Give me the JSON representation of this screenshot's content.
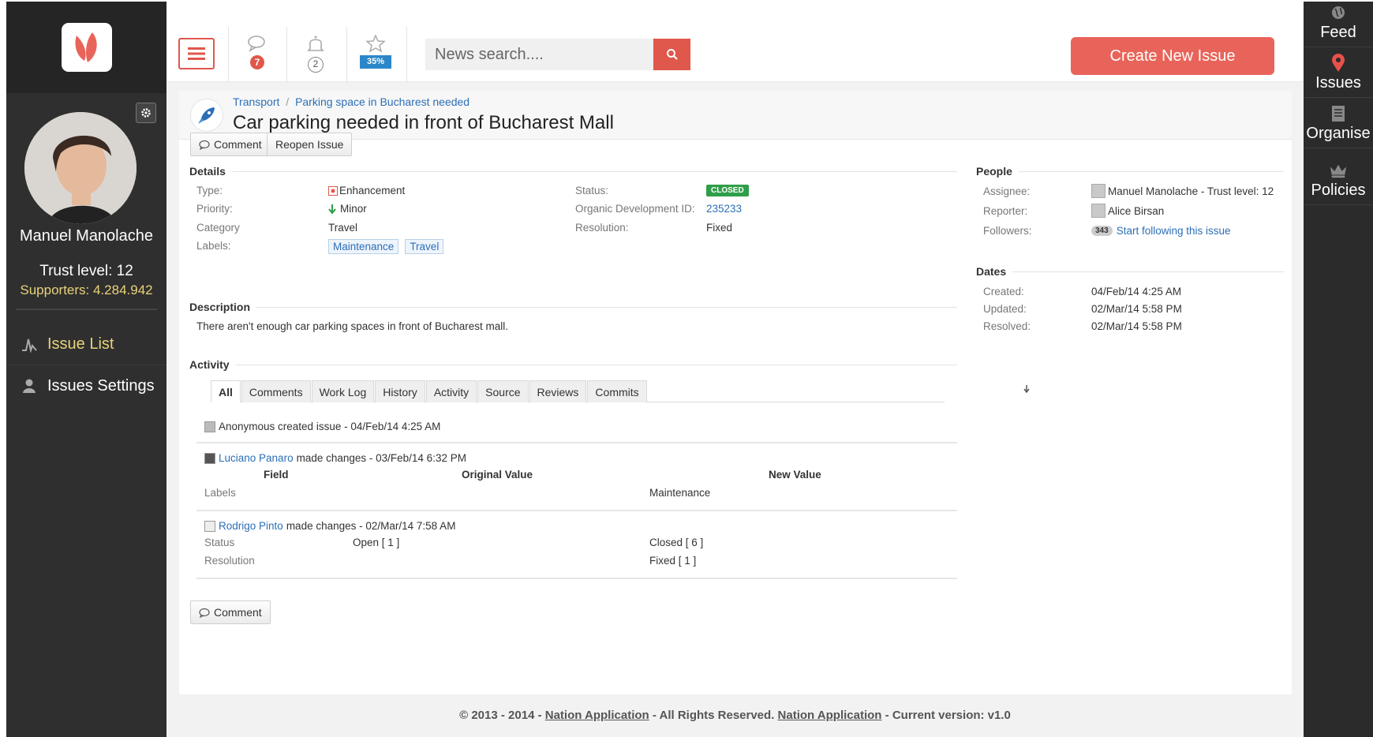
{
  "user": {
    "name": "Manuel Manolache",
    "trust_level": "Trust level: 12",
    "supporters": "Supporters: 4.284.942"
  },
  "left_nav": {
    "items": [
      {
        "label": "Issue List",
        "icon": "pulse-icon"
      },
      {
        "label": "Issues Settings",
        "icon": "user-icon"
      }
    ]
  },
  "right_nav": {
    "items": [
      {
        "label": "Feed",
        "icon": "globe-icon"
      },
      {
        "label": "Issues",
        "icon": "map-pin-icon"
      },
      {
        "label": "Organise",
        "icon": "document-icon"
      },
      {
        "label": "Policies",
        "icon": "crown-icon"
      }
    ]
  },
  "topbar": {
    "messages_count": "7",
    "notifications_count": "2",
    "favorites_percent": "35%",
    "search_placeholder": "News search....",
    "create_button": "Create New Issue"
  },
  "issue": {
    "breadcrumb": [
      "Transport",
      "Parking space in Bucharest needed"
    ],
    "breadcrumb_sep": "/",
    "title": "Car parking needed in front of Bucharest Mall",
    "buttons": {
      "comment": "Comment",
      "reopen": "Reopen Issue"
    },
    "details_heading": "Details",
    "details": {
      "type_label": "Type:",
      "type_value": "Enhancement",
      "priority_label": "Priority:",
      "priority_value": "Minor",
      "category_label": "Category",
      "category_value": "Travel",
      "labels_label": "Labels:",
      "labels": [
        "Maintenance",
        "Travel"
      ],
      "status_label": "Status:",
      "status_value": "CLOSED",
      "org_id_label": "Organic Development ID:",
      "org_id_value": "235233",
      "resolution_label": "Resolution:",
      "resolution_value": "Fixed"
    },
    "description_heading": "Description",
    "description": "There aren't enough car parking spaces in front of Bucharest mall.",
    "activity_heading": "Activity",
    "activity_tabs": [
      "All",
      "Comments",
      "Work Log",
      "History",
      "Activity",
      "Source",
      "Reviews",
      "Commits"
    ],
    "activity": {
      "entry1": "Anonymous created issue - 04/Feb/14 4:25 AM",
      "entry2_user": "Luciano Panaro",
      "entry2_text": "made changes - 03/Feb/14 6:32 PM",
      "col_field": "Field",
      "col_original": "Original Value",
      "col_new": "New Value",
      "row_labels_field": "Labels",
      "row_labels_new": "Maintenance",
      "entry3_user": "Rodrigo Pinto",
      "entry3_text": "made changes - 02/Mar/14 7:58 AM",
      "row_status_field": "Status",
      "row_status_orig": "Open [ 1 ]",
      "row_status_new": "Closed [ 6 ]",
      "row_res_field": "Resolution",
      "row_res_new": "Fixed [ 1 ]"
    },
    "people_heading": "People",
    "people": {
      "assignee_label": "Assignee:",
      "assignee_value": "Manuel Manolache - Trust level: 12",
      "reporter_label": "Reporter:",
      "reporter_value": "Alice Birsan",
      "followers_label": "Followers:",
      "followers_count": "343",
      "followers_link": "Start following this issue"
    },
    "dates_heading": "Dates",
    "dates": {
      "created_label": "Created:",
      "created_value": "04/Feb/14 4:25 AM",
      "updated_label": "Updated:",
      "updated_value": "02/Mar/14 5:58 PM",
      "resolved_label": "Resolved:",
      "resolved_value": "02/Mar/14 5:58 PM"
    }
  },
  "footer": {
    "copyright": "© 2013 - 2014 -",
    "link1": "Nation Application",
    "middle": "- All Rights Reserved.",
    "link2": "Nation Application",
    "version": "- Current version: v1.0"
  },
  "colors": {
    "accent": "#e0574b",
    "sidebar": "#2f2f2f",
    "highlight": "#e9d27a",
    "link": "#2c6fb7",
    "status_closed": "#2f9e48"
  }
}
